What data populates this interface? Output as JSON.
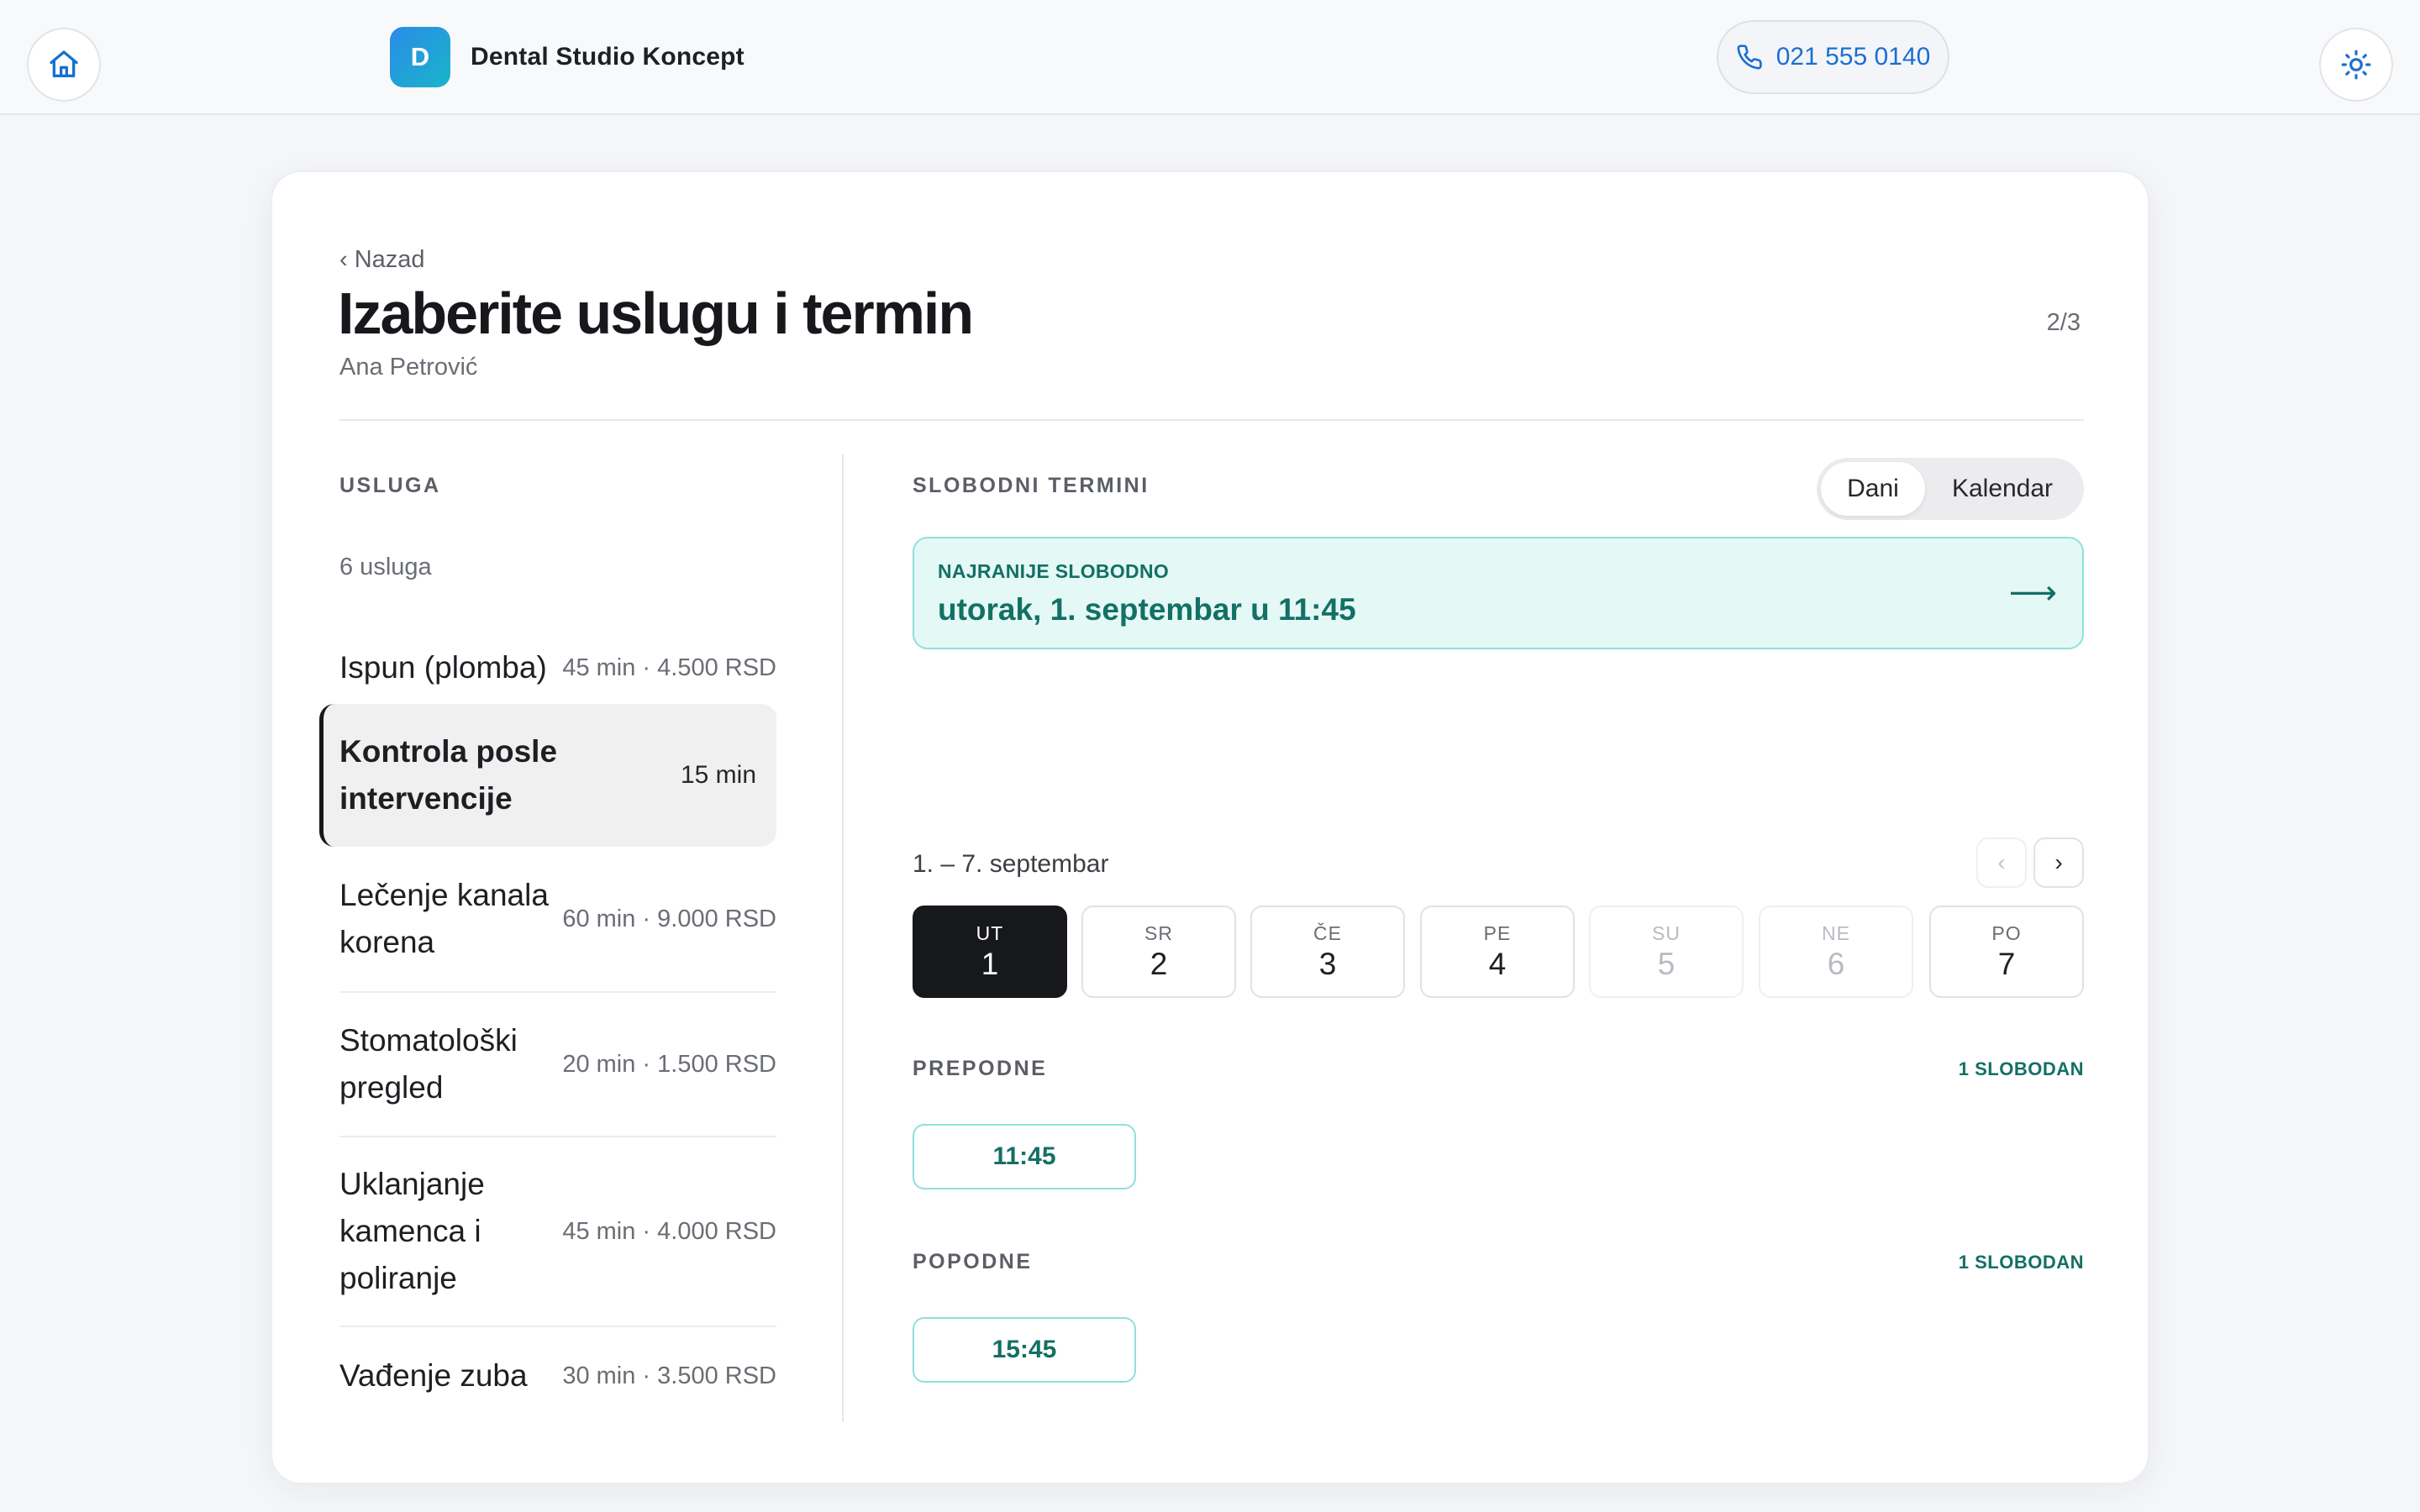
{
  "header": {
    "brand_initial": "D",
    "brand_name": "Dental Studio Koncept",
    "phone": "021 555 0140"
  },
  "page": {
    "back_label": "‹ Nazad",
    "title": "Izaberite uslugu i termin",
    "patient": "Ana Petrović",
    "step": "2/3"
  },
  "services": {
    "section_label": "USLUGA",
    "count_label": "6 usluga",
    "items": [
      {
        "name": "Ispun (plomba)",
        "meta": "45 min · 4.500 RSD"
      },
      {
        "name": "Kontrola posle intervencije",
        "meta": "15 min",
        "selected": true
      },
      {
        "name": "Lečenje kanala korena",
        "meta": "60 min · 9.000 RSD"
      },
      {
        "name": "Stomatološki pregled",
        "meta": "20 min · 1.500 RSD"
      },
      {
        "name": "Uklanjanje kamenca i poliranje",
        "meta": "45 min · 4.000 RSD"
      },
      {
        "name": "Vađenje zuba",
        "meta": "30 min · 3.500 RSD"
      }
    ]
  },
  "slots": {
    "section_label": "SLOBODNI TERMINI",
    "view_toggle": {
      "days": "Dani",
      "calendar": "Kalendar",
      "active": "Dani"
    },
    "earliest": {
      "label": "NAJRANIJE SLOBODNO",
      "value": "utorak, 1. septembar u 11:45",
      "arrow": "⟶"
    },
    "week_range": "1. – 7. septembar",
    "prev_label": "‹",
    "next_label": "›",
    "days": [
      {
        "name": "UT",
        "date": "1",
        "state": "active"
      },
      {
        "name": "SR",
        "date": "2",
        "state": "available"
      },
      {
        "name": "ČE",
        "date": "3",
        "state": "available"
      },
      {
        "name": "PE",
        "date": "4",
        "state": "available"
      },
      {
        "name": "SU",
        "date": "5",
        "state": "disabled"
      },
      {
        "name": "NE",
        "date": "6",
        "state": "disabled"
      },
      {
        "name": "PO",
        "date": "7",
        "state": "available"
      }
    ],
    "periods": [
      {
        "label": "PREPODNE",
        "count": "1 SLOBODAN",
        "times": [
          "11:45"
        ]
      },
      {
        "label": "POPODNE",
        "count": "1 SLOBODAN",
        "times": [
          "15:45"
        ]
      }
    ]
  },
  "icons": {
    "home": "home-icon",
    "theme": "sun-icon",
    "phone": "phone-icon"
  },
  "colors": {
    "accent_teal": "#137064",
    "teal_border": "#8fe1d8",
    "teal_bg": "#e4f8f6",
    "phone_blue": "#1a6fd1",
    "selected_day": "#17181b"
  }
}
